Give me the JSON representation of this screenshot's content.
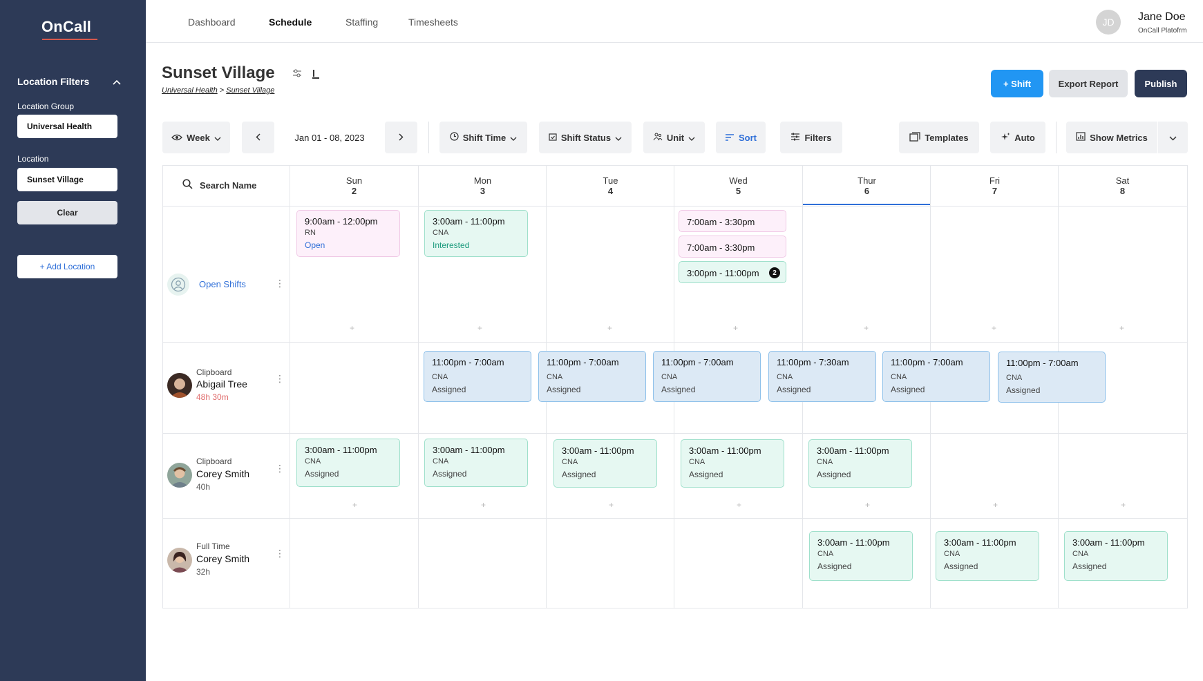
{
  "sidebar": {
    "logo": "OnCall",
    "filters_title": "Location Filters",
    "location_group_label": "Location Group",
    "location_group_value": "Universal Health",
    "location_label": "Location",
    "location_value": "Sunset Village",
    "clear_label": "Clear",
    "add_location_label": "+ Add Location"
  },
  "nav": {
    "items": [
      "Dashboard",
      "Schedule",
      "Staffing",
      "Timesheets"
    ],
    "active": "Schedule"
  },
  "user": {
    "initials": "JD",
    "name": "Jane Doe",
    "org": "OnCall Platofrm"
  },
  "page": {
    "title": "Sunset Village",
    "breadcrumb": [
      "Universal Health",
      "Sunset Village"
    ],
    "breadcrumb_sep": ">"
  },
  "actions": {
    "shift": "+ Shift",
    "export": "Export Report",
    "publish": "Publish"
  },
  "toolbar": {
    "week": "Week",
    "date_range": "Jan 01 - 08, 2023",
    "shift_time": "Shift Time",
    "shift_status": "Shift Status",
    "unit": "Unit",
    "sort": "Sort",
    "filters": "Filters",
    "templates": "Templates",
    "auto": "Auto",
    "show_metrics": "Show Metrics"
  },
  "search": {
    "placeholder": "Search Name"
  },
  "days": [
    {
      "name": "Sun",
      "num": "2"
    },
    {
      "name": "Mon",
      "num": "3"
    },
    {
      "name": "Tue",
      "num": "4"
    },
    {
      "name": "Wed",
      "num": "5"
    },
    {
      "name": "Thur",
      "num": "6"
    },
    {
      "name": "Fri",
      "num": "7"
    },
    {
      "name": "Sat",
      "num": "8"
    }
  ],
  "open_shifts": {
    "label": "Open Shifts",
    "sun": {
      "time": "9:00am - 12:00pm",
      "role": "RN",
      "status": "Open"
    },
    "mon": {
      "time": "3:00am - 11:00pm",
      "role": "CNA",
      "status": "Interested"
    },
    "wed": [
      {
        "time": "7:00am - 3:30pm"
      },
      {
        "time": "7:00am - 3:30pm"
      },
      {
        "time": "3:00pm - 11:00pm",
        "badge": "2"
      }
    ]
  },
  "employees": [
    {
      "type": "Clipboard",
      "name": "Abigail Tree",
      "hours": "48h 30m",
      "shifts": [
        {
          "time": "11:00pm - 7:00am",
          "role": "CNA",
          "status": "Assigned"
        },
        {
          "time": "11:00pm - 7:00am",
          "role": "CNA",
          "status": "Assigned"
        },
        {
          "time": "11:00pm - 7:00am",
          "role": "CNA",
          "status": "Assigned"
        },
        {
          "time": "11:00pm - 7:30am",
          "role": "CNA",
          "status": "Assigned"
        },
        {
          "time": "11:00pm - 7:00am",
          "role": "CNA",
          "status": "Assigned"
        },
        {
          "time": "11:00pm - 7:00am",
          "role": "CNA",
          "status": "Assigned"
        }
      ]
    },
    {
      "type": "Clipboard",
      "name": "Corey Smith",
      "hours": "40h",
      "shifts": [
        {
          "time": "3:00am - 11:00pm",
          "role": "CNA",
          "status": "Assigned"
        },
        {
          "time": "3:00am - 11:00pm",
          "role": "CNA",
          "status": "Assigned"
        },
        {
          "time": "3:00am - 11:00pm",
          "role": "CNA",
          "status": "Assigned"
        },
        {
          "time": "3:00am - 11:00pm",
          "role": "CNA",
          "status": "Assigned"
        },
        {
          "time": "3:00am - 11:00pm",
          "role": "CNA",
          "status": "Assigned"
        }
      ]
    },
    {
      "type": "Full Time",
      "name": "Corey Smith",
      "hours": "32h",
      "shifts": [
        {
          "time": "3:00am - 11:00pm",
          "role": "CNA",
          "status": "Assigned"
        },
        {
          "time": "3:00am - 11:00pm",
          "role": "CNA",
          "status": "Assigned"
        },
        {
          "time": "3:00am - 11:00pm",
          "role": "CNA",
          "status": "Assigned"
        }
      ]
    }
  ],
  "colors": {
    "sidebar": "#2d3a57",
    "primary": "#2196f3",
    "link": "#2f6fd8",
    "open_card": "#fdf0fa",
    "assigned_green": "#e6f8f2",
    "assigned_blue": "#dce9f5",
    "hours_warning": "#e06c6c"
  }
}
